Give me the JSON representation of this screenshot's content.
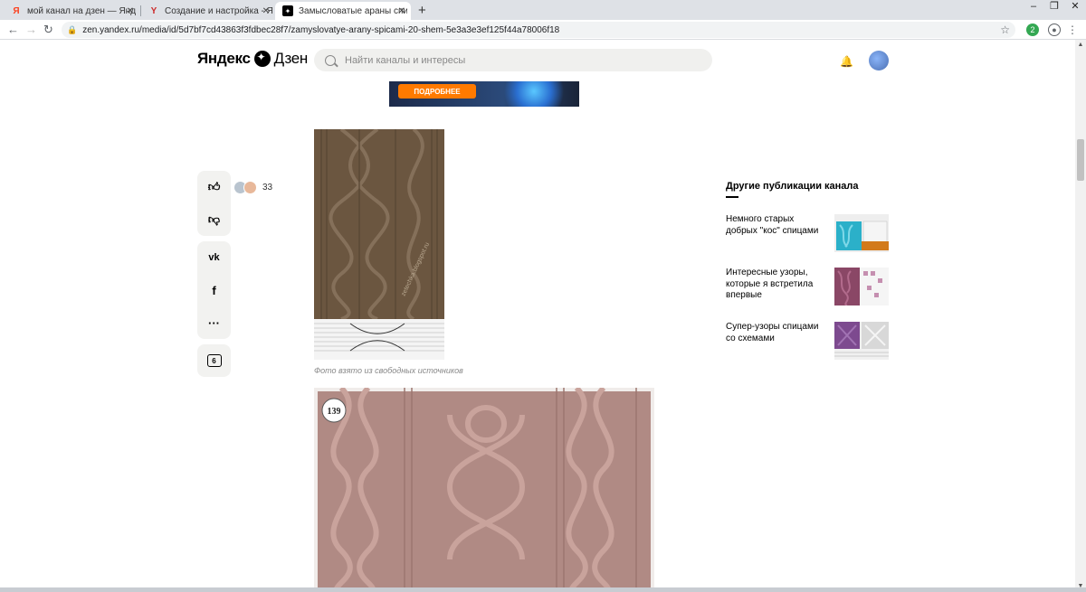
{
  "browser": {
    "tabs": [
      {
        "title": "мой канал на дзен — Яндекс: н",
        "icon": "Я",
        "icon_color": "#fc3f1d"
      },
      {
        "title": "Создание и настройка - Яндекс",
        "icon": "Y",
        "icon_color": "#cc2a2a"
      },
      {
        "title": "Замысловатые араны спицами",
        "icon": "✦",
        "icon_color": "#000000"
      }
    ],
    "new_tab": "+",
    "url": "zen.yandex.ru/media/id/5d7bf7cd43863f3fdbec28f7/zamyslovatye-arany-spicami-20-shem-5e3a3e3ef125f44a78006f18",
    "ext_badge": "2"
  },
  "header": {
    "logo_yandex": "Яндекс",
    "logo_dzen": "Дзен",
    "search_placeholder": "Найти каналы и интересы"
  },
  "ad": {
    "button": "ПОДРОБНЕЕ"
  },
  "article": {
    "likes_count": "33",
    "comments_count": "6",
    "caption": "Фото взято из свободных источников",
    "badge_number": "139",
    "watermark": "zetechka.blogspot.ru"
  },
  "others": {
    "title": "Другие публикации канала",
    "items": [
      {
        "title": "Немного старых добрых \"кос\" спицами"
      },
      {
        "title": "Интересные узоры, которые я встретила впервые"
      },
      {
        "title": "Супер-узоры спицами со схемами"
      }
    ]
  },
  "colors": {
    "knit_brown": "#6b5640",
    "knit_pink": "#b08a84",
    "accent_orange": "#ff7a00"
  }
}
